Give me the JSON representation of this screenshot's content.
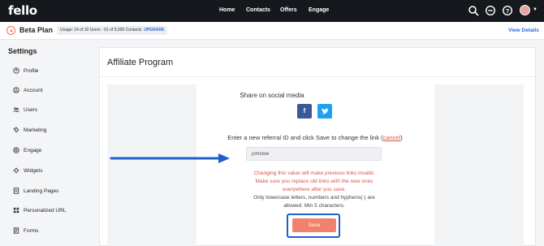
{
  "topnav": {
    "logo": "fello",
    "links": [
      "Home",
      "Contacts",
      "Offers",
      "Engage"
    ],
    "icons": [
      "search-icon",
      "minus-circle-icon",
      "help-icon",
      "avatar"
    ]
  },
  "planbar": {
    "title": "Beta Plan",
    "usage": "Usage: 14 of 10 Users · 61 of 5,000 Contacts",
    "upgrade": "UPGRADE",
    "view_details": "View Details"
  },
  "sidebar": {
    "title": "Settings",
    "items": [
      {
        "label": "Profile",
        "icon": "profile-icon"
      },
      {
        "label": "Account",
        "icon": "account-icon"
      },
      {
        "label": "Users",
        "icon": "users-icon"
      },
      {
        "label": "Marketing",
        "icon": "marketing-icon"
      },
      {
        "label": "Engage",
        "icon": "engage-icon"
      },
      {
        "label": "Widgets",
        "icon": "widgets-icon"
      },
      {
        "label": "Landing Pages",
        "icon": "landing-pages-icon"
      },
      {
        "label": "Personalized URL",
        "icon": "url-icon"
      },
      {
        "label": "Forms",
        "icon": "forms-icon"
      }
    ]
  },
  "main": {
    "title": "Affiliate Program",
    "share_title": "Share on social media",
    "facebook_label": "f",
    "instruction": "Enter a new referral ID and click Save to change the link (",
    "cancel": "cancel",
    "instruction_end": ")",
    "referral_input": {
      "value": "johndoe",
      "placeholder": ""
    },
    "warning_line1": "Changing this value will make previous links invalid.",
    "warning_line2": "Make sure you replace old links with the new ones",
    "warning_line3": "everywhere after you save.",
    "rules_line1": "Only lowercase letters, numbers and hyphens(-) are",
    "rules_line2": "allowed. Min 5 characters.",
    "save": "Save"
  },
  "colors": {
    "nav_bg": "#15181d",
    "accent_blue": "#2d6bd1",
    "warning_red": "#d9534f",
    "save_button": "#f0816d",
    "facebook": "#3b5998",
    "twitter": "#1da1f2",
    "annotation_blue": "#1f5fc8"
  }
}
